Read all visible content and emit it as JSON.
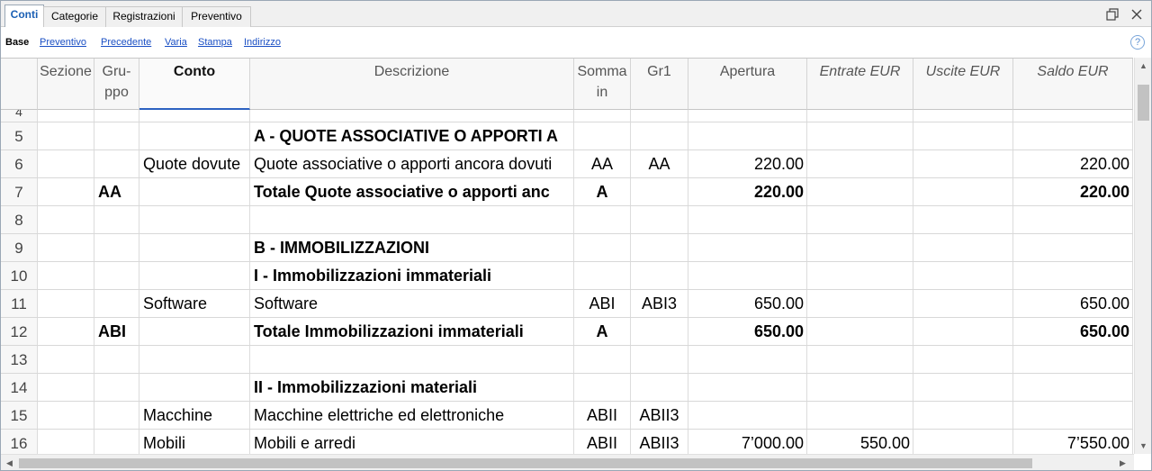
{
  "tabs": [
    "Conti",
    "Categorie",
    "Registrazioni",
    "Preventivo"
  ],
  "links": [
    "Base",
    "Preventivo",
    "Precedente",
    "Varia",
    "Stampa",
    "Indirizzo"
  ],
  "help_label": "?",
  "columns": {
    "sezione": "Sezione",
    "gruppo_1": "Gru-",
    "gruppo_2": "ppo",
    "conto": "Conto",
    "descrizione": "Descrizione",
    "somma_1": "Somma",
    "somma_2": "in",
    "gr1": "Gr1",
    "apertura": "Apertura",
    "entrate": "Entrate EUR",
    "uscite": "Uscite EUR",
    "saldo": "Saldo EUR"
  },
  "partial_row_number": "4",
  "rows": [
    {
      "n": "5",
      "sezione": "",
      "gruppo": "",
      "conto": "",
      "descrizione": "A - QUOTE ASSOCIATIVE O APPORTI A",
      "somma": "",
      "gr1": "",
      "apertura": "",
      "entrate": "",
      "uscite": "",
      "saldo": "",
      "bold": true
    },
    {
      "n": "6",
      "sezione": "",
      "gruppo": "",
      "conto": "Quote dovute",
      "descrizione": "Quote associative o apporti ancora dovuti",
      "somma": "AA",
      "gr1": "AA",
      "apertura": "220.00",
      "entrate": "",
      "uscite": "",
      "saldo": "220.00",
      "bold": false
    },
    {
      "n": "7",
      "sezione": "",
      "gruppo": "AA",
      "conto": "",
      "descrizione": "Totale Quote associative o apporti anc",
      "somma": "A",
      "gr1": "",
      "apertura": "220.00",
      "entrate": "",
      "uscite": "",
      "saldo": "220.00",
      "bold": true
    },
    {
      "n": "8",
      "sezione": "",
      "gruppo": "",
      "conto": "",
      "descrizione": "",
      "somma": "",
      "gr1": "",
      "apertura": "",
      "entrate": "",
      "uscite": "",
      "saldo": "",
      "bold": false
    },
    {
      "n": "9",
      "sezione": "",
      "gruppo": "",
      "conto": "",
      "descrizione": "B - IMMOBILIZZAZIONI",
      "somma": "",
      "gr1": "",
      "apertura": "",
      "entrate": "",
      "uscite": "",
      "saldo": "",
      "bold": true
    },
    {
      "n": "10",
      "sezione": "",
      "gruppo": "",
      "conto": "",
      "descrizione": "I - Immobilizzazioni immateriali",
      "somma": "",
      "gr1": "",
      "apertura": "",
      "entrate": "",
      "uscite": "",
      "saldo": "",
      "bold": true
    },
    {
      "n": "11",
      "sezione": "",
      "gruppo": "",
      "conto": "Software",
      "descrizione": "Software",
      "somma": "ABI",
      "gr1": "ABI3",
      "apertura": "650.00",
      "entrate": "",
      "uscite": "",
      "saldo": "650.00",
      "bold": false
    },
    {
      "n": "12",
      "sezione": "",
      "gruppo": "ABI",
      "conto": "",
      "descrizione": "Totale Immobilizzazioni immateriali",
      "somma": "A",
      "gr1": "",
      "apertura": "650.00",
      "entrate": "",
      "uscite": "",
      "saldo": "650.00",
      "bold": true
    },
    {
      "n": "13",
      "sezione": "",
      "gruppo": "",
      "conto": "",
      "descrizione": "",
      "somma": "",
      "gr1": "",
      "apertura": "",
      "entrate": "",
      "uscite": "",
      "saldo": "",
      "bold": false
    },
    {
      "n": "14",
      "sezione": "",
      "gruppo": "",
      "conto": "",
      "descrizione": "II - Immobilizzazioni materiali",
      "somma": "",
      "gr1": "",
      "apertura": "",
      "entrate": "",
      "uscite": "",
      "saldo": "",
      "bold": true
    },
    {
      "n": "15",
      "sezione": "",
      "gruppo": "",
      "conto": "Macchine",
      "descrizione": "Macchine elettriche ed elettroniche",
      "somma": "ABII",
      "gr1": "ABII3",
      "apertura": "",
      "entrate": "",
      "uscite": "",
      "saldo": "",
      "bold": false
    },
    {
      "n": "16",
      "sezione": "",
      "gruppo": "",
      "conto": "Mobili",
      "descrizione": "Mobili e arredi",
      "somma": "ABII",
      "gr1": "ABII3",
      "apertura": "7’000.00",
      "entrate": "550.00",
      "uscite": "",
      "saldo": "7’550.00",
      "bold": false
    }
  ]
}
